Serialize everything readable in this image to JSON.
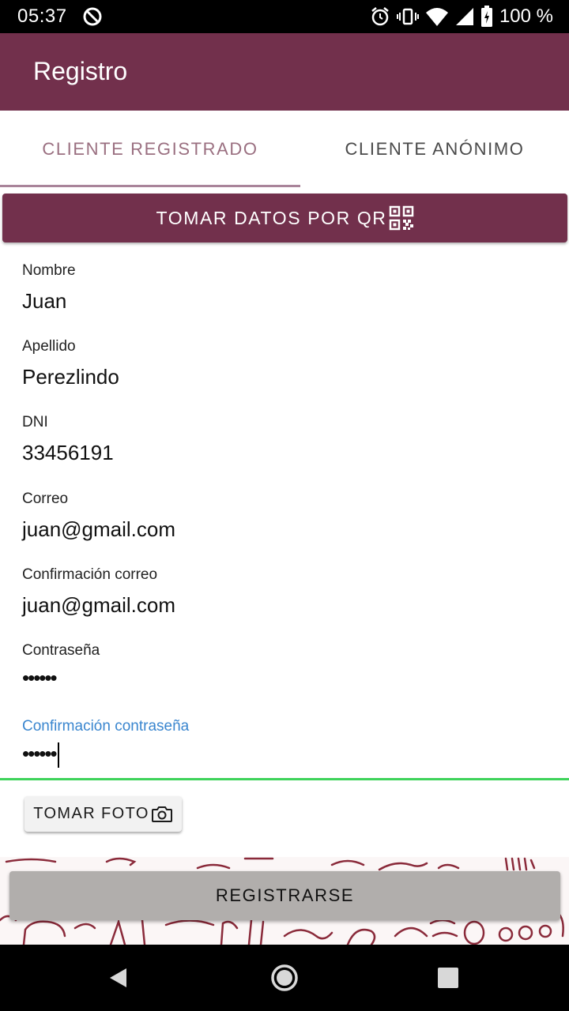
{
  "status_bar": {
    "time": "05:37",
    "battery": "100 %",
    "icons": [
      "sync-off-icon",
      "alarm-icon",
      "vibrate-icon",
      "wifi-icon",
      "signal-icon",
      "battery-icon"
    ]
  },
  "app_bar": {
    "title": "Registro"
  },
  "tabs": [
    {
      "label": "CLIENTE REGISTRADO",
      "selected": true
    },
    {
      "label": "CLIENTE ANÓNIMO",
      "selected": false
    }
  ],
  "qr_button": {
    "label": "TOMAR DATOS POR QR",
    "icon": "qr-code-icon"
  },
  "form": {
    "nombre": {
      "label": "Nombre",
      "value": "Juan"
    },
    "apellido": {
      "label": "Apellido",
      "value": "Perezlindo"
    },
    "dni": {
      "label": "DNI",
      "value": "33456191"
    },
    "correo": {
      "label": "Correo",
      "value": "juan@gmail.com"
    },
    "confirmacion_correo": {
      "label": "Confirmación correo",
      "value": "juan@gmail.com"
    },
    "contrasena": {
      "label": "Contraseña",
      "value": "••••••"
    },
    "confirmacion_contrasena": {
      "label": "Confirmación contraseña",
      "value": "••••••",
      "focused": true
    }
  },
  "photo_button": {
    "label": "TOMAR FOTO",
    "icon": "camera-icon"
  },
  "register_button": {
    "label": "REGISTRARSE"
  },
  "colors": {
    "primary": "#72304c",
    "tab_selected": "#9a6f80",
    "focus_label": "#3a86cf",
    "focus_line": "#3ed35a",
    "register_button": "#b1aeac"
  },
  "nav_bar": {
    "icons": [
      "back-icon",
      "home-icon",
      "recents-icon"
    ]
  }
}
